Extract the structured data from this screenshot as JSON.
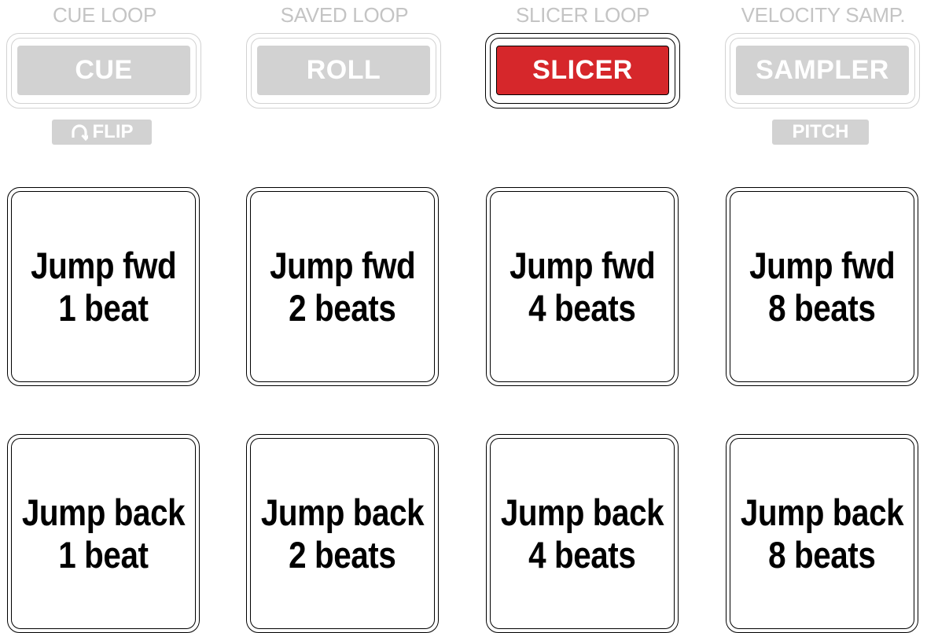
{
  "mode_columns": [
    {
      "label": "CUE LOOP",
      "button": "CUE",
      "active": false
    },
    {
      "label": "SAVED LOOP",
      "button": "ROLL",
      "active": false
    },
    {
      "label": "SLICER LOOP",
      "button": "SLICER",
      "active": true
    },
    {
      "label": "VELOCITY SAMP.",
      "button": "SAMPLER",
      "active": false
    }
  ],
  "sub_labels": {
    "flip": "FLIP",
    "flip_icon": "flip-loop-icon",
    "pitch": "PITCH"
  },
  "colors": {
    "active_button": "#d6272b",
    "inactive_button": "#d2d2d2",
    "label_gray": "#c4c4c4"
  },
  "pads": [
    {
      "line1": "Jump fwd",
      "line2": "1 beat"
    },
    {
      "line1": "Jump fwd",
      "line2": "2 beats"
    },
    {
      "line1": "Jump fwd",
      "line2": "4 beats"
    },
    {
      "line1": "Jump fwd",
      "line2": "8 beats"
    },
    {
      "line1": "Jump back",
      "line2": "1 beat"
    },
    {
      "line1": "Jump back",
      "line2": "2 beats"
    },
    {
      "line1": "Jump back",
      "line2": "4 beats"
    },
    {
      "line1": "Jump back",
      "line2": "8 beats"
    }
  ]
}
